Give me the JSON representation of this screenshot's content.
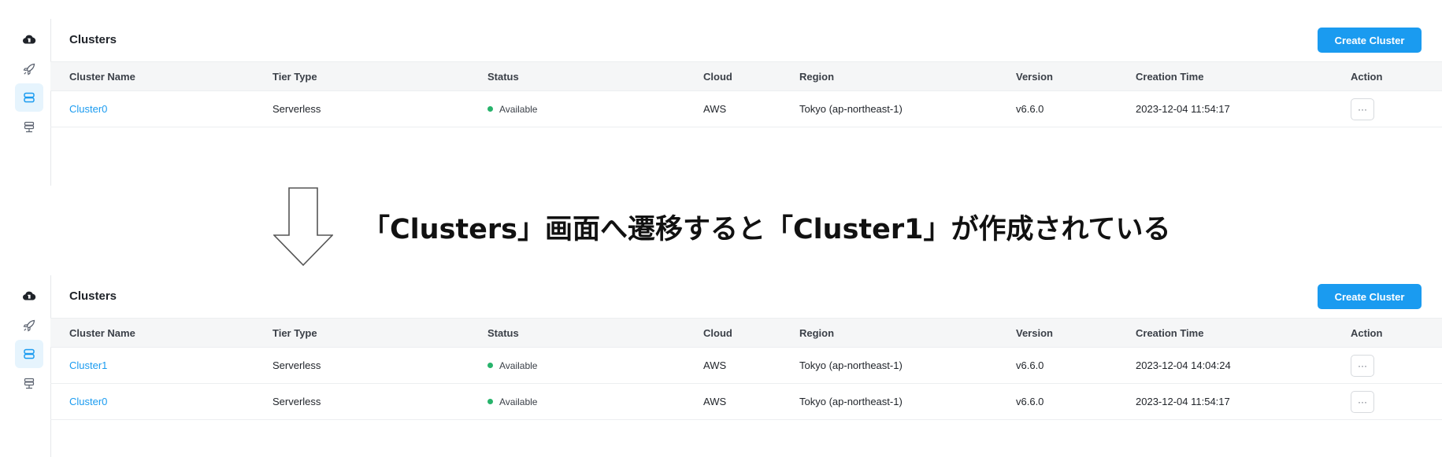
{
  "caption": "「Clusters」画面へ遷移すると「Cluster1」が作成されている",
  "colors": {
    "accent": "#1a9bf0",
    "status_available": "#27b36b",
    "header_bg": "#f5f6f7"
  },
  "sidebar_icons": [
    "cloud-logo-icon",
    "rocket-icon",
    "database-icon",
    "network-icon"
  ],
  "before": {
    "title": "Clusters",
    "create_button": "Create Cluster",
    "columns": [
      "Cluster Name",
      "Tier Type",
      "Status",
      "Cloud",
      "Region",
      "Version",
      "Creation Time",
      "Action"
    ],
    "rows": [
      {
        "name": "Cluster0",
        "tier": "Serverless",
        "status": "Available",
        "cloud": "AWS",
        "region": "Tokyo (ap-northeast-1)",
        "version": "v6.6.0",
        "created": "2023-12-04 11:54:17",
        "action": "···"
      }
    ]
  },
  "after": {
    "title": "Clusters",
    "create_button": "Create Cluster",
    "columns": [
      "Cluster Name",
      "Tier Type",
      "Status",
      "Cloud",
      "Region",
      "Version",
      "Creation Time",
      "Action"
    ],
    "rows": [
      {
        "name": "Cluster1",
        "tier": "Serverless",
        "status": "Available",
        "cloud": "AWS",
        "region": "Tokyo (ap-northeast-1)",
        "version": "v6.6.0",
        "created": "2023-12-04 14:04:24",
        "action": "···"
      },
      {
        "name": "Cluster0",
        "tier": "Serverless",
        "status": "Available",
        "cloud": "AWS",
        "region": "Tokyo (ap-northeast-1)",
        "version": "v6.6.0",
        "created": "2023-12-04 11:54:17",
        "action": "···"
      }
    ]
  }
}
